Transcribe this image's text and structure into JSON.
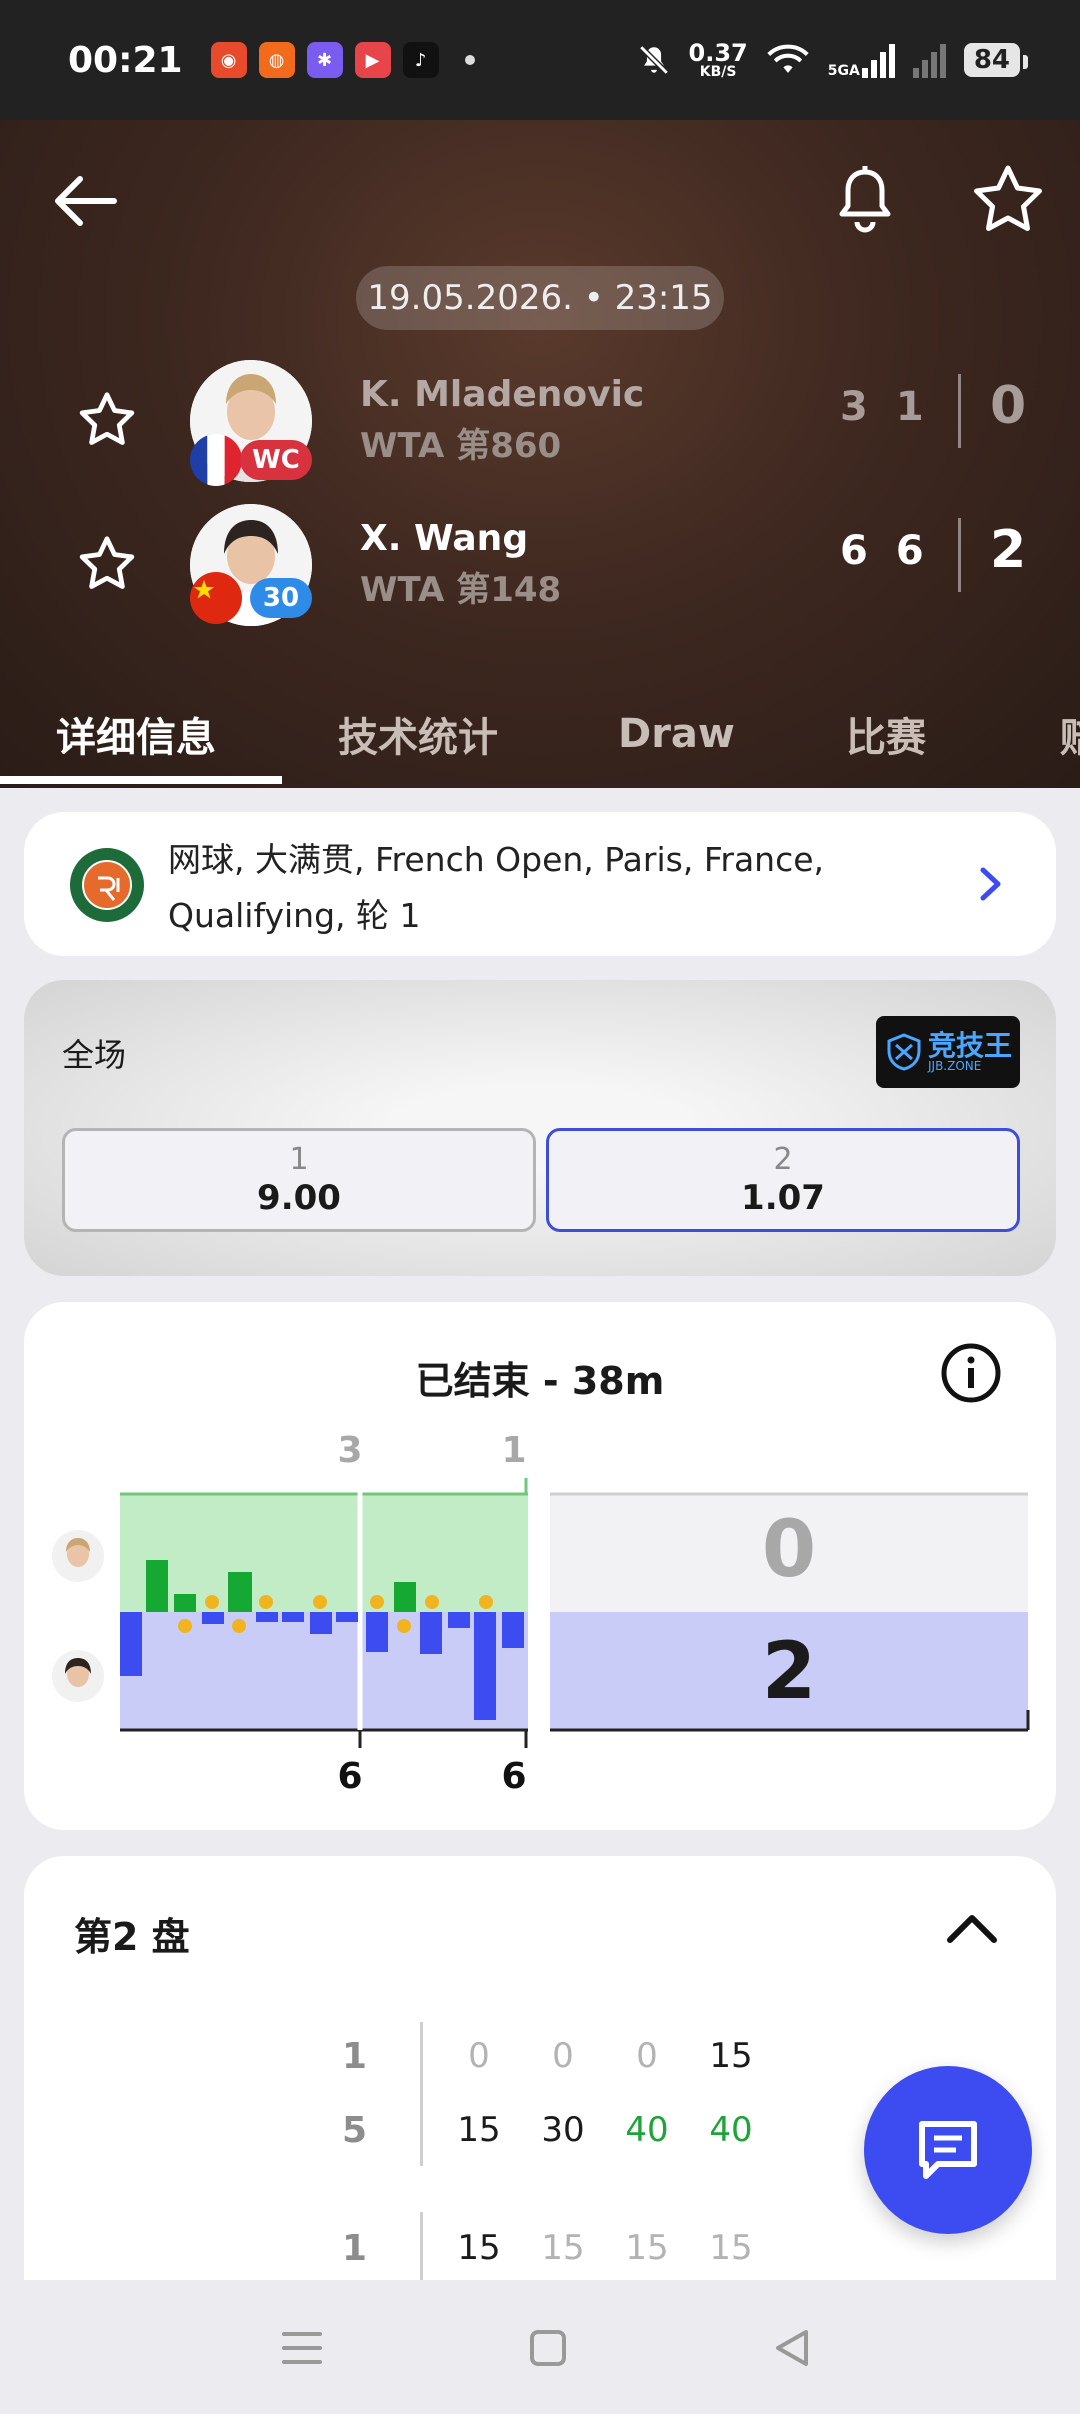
{
  "status_bar": {
    "time": "00:21",
    "net_speed_value": "0.37",
    "net_speed_unit": "KB/S",
    "network_label": "5GA",
    "battery": "84"
  },
  "match": {
    "datetime": "19.05.2026. • 23:15",
    "players": [
      {
        "name": "K. Mladenovic",
        "rank": "WTA 第860",
        "badge": "WC",
        "set_scores": [
          "3",
          "1"
        ],
        "final": "0"
      },
      {
        "name": "X. Wang",
        "rank": "WTA 第148",
        "badge": "30",
        "set_scores": [
          "6",
          "6"
        ],
        "final": "2"
      }
    ]
  },
  "tabs": [
    "详细信息",
    "技术统计",
    "Draw",
    "比赛",
    "赔"
  ],
  "tournament": {
    "text": "网球, 大满贯, French Open, Paris, France, Qualifying, 轮 1"
  },
  "odds": {
    "label": "全场",
    "sponsor": "竞技王",
    "sponsor_sub": "JJB.ZONE",
    "options": [
      {
        "label": "1",
        "value": "9.00"
      },
      {
        "label": "2",
        "value": "1.07"
      }
    ]
  },
  "timeline": {
    "title": "已结束 - 38m",
    "set_top": [
      "3",
      "1"
    ],
    "set_bottom": [
      "6",
      "6"
    ],
    "final_top": "0",
    "final_bottom": "2"
  },
  "set_detail": {
    "title": "第2 盘",
    "rows": [
      {
        "game": "1",
        "points": [
          "0",
          "0",
          "0",
          "15"
        ]
      },
      {
        "game": "5",
        "points": [
          "15",
          "30",
          "40",
          "40"
        ]
      },
      {
        "game": "1",
        "points": [
          "15",
          "15",
          "15",
          "15"
        ]
      }
    ]
  },
  "colors": {
    "accent": "#3d4cf0",
    "green": "#1fa33a",
    "player1_band": "#c2ecc5",
    "player2_band": "#c9ccf7"
  }
}
